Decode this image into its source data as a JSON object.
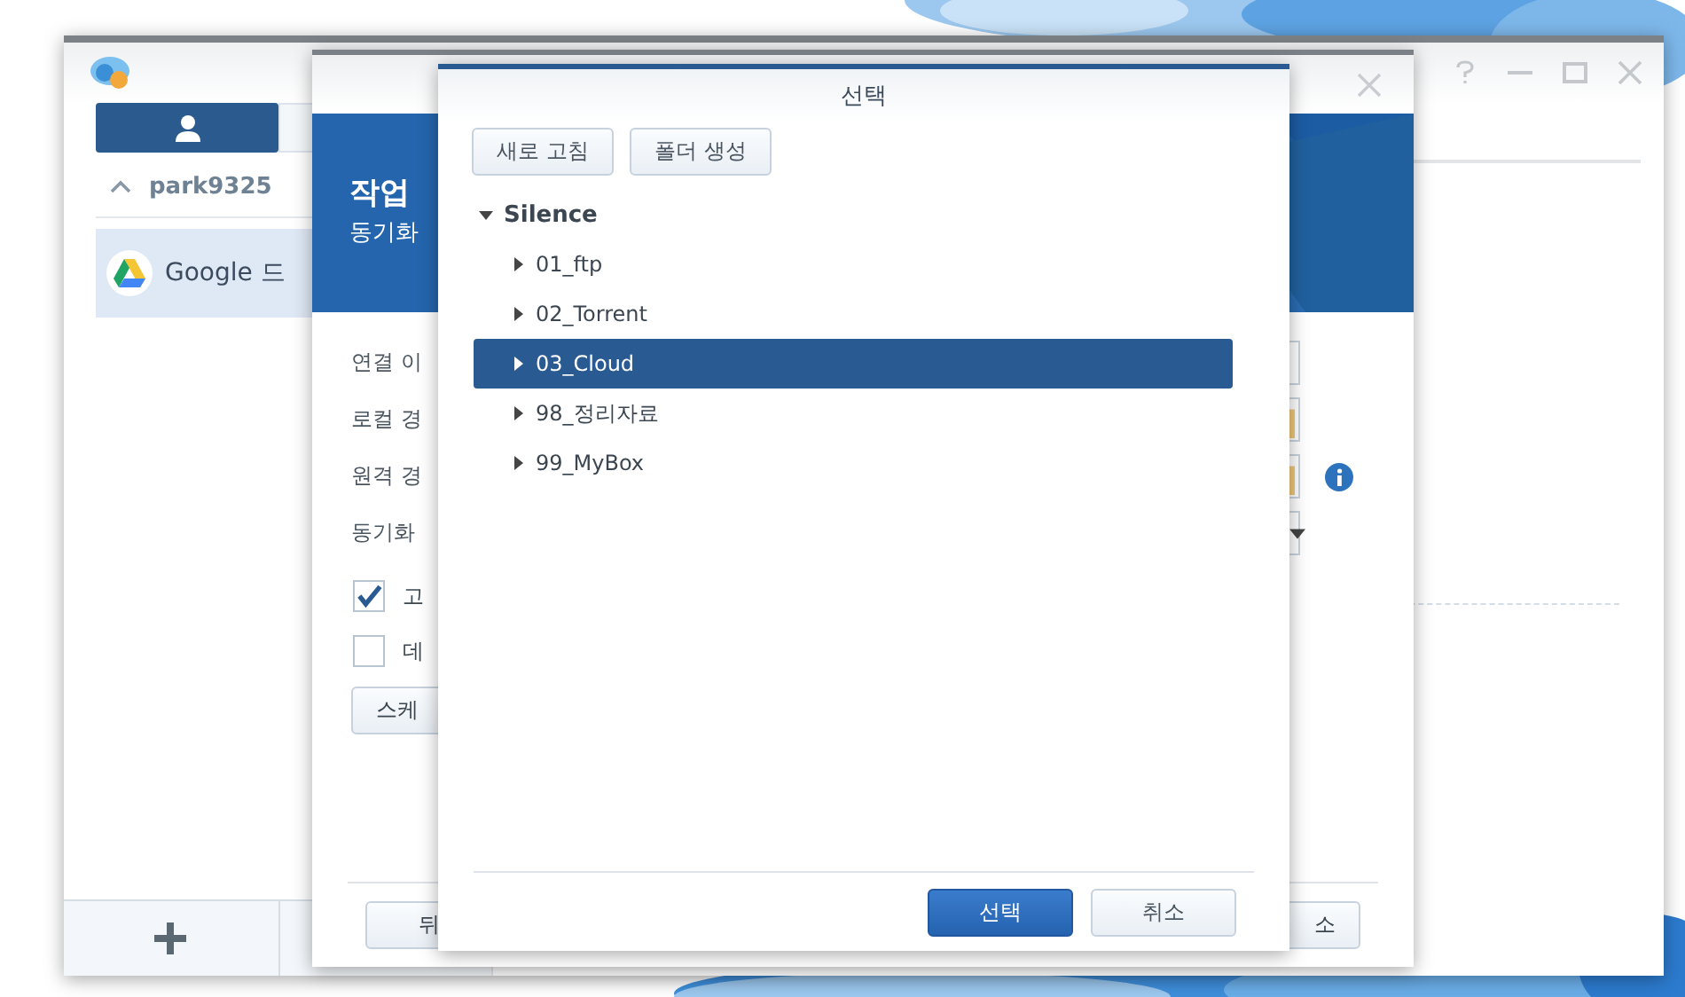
{
  "main_window": {
    "account": {
      "name": "park9325",
      "expanded": true
    },
    "connections": [
      {
        "label": "Google 드",
        "selected": true
      }
    ]
  },
  "wizard": {
    "title": "작업",
    "subtitle": "동기화",
    "fields": [
      {
        "label": "연결 이",
        "kind": "text",
        "info": false
      },
      {
        "label": "로컬 경",
        "kind": "folder",
        "info": false
      },
      {
        "label": "원격 경",
        "kind": "folder",
        "info": true
      },
      {
        "label": "동기화",
        "kind": "select",
        "info": false
      }
    ],
    "checkboxes": [
      {
        "label": "고",
        "checked": true
      },
      {
        "label": "데",
        "checked": false
      }
    ],
    "schedule_button": "스케",
    "buttons": [
      "뒤",
      "소"
    ]
  },
  "dialog": {
    "title": "선택",
    "toolbar": [
      "새로 고침",
      "폴더 생성"
    ],
    "tree": {
      "label": "Silence",
      "expanded": true,
      "children": [
        {
          "label": "01_ftp",
          "expanded": false,
          "selected": false
        },
        {
          "label": "02_Torrent",
          "expanded": false,
          "selected": false
        },
        {
          "label": "03_Cloud",
          "expanded": false,
          "selected": true
        },
        {
          "label": "98_정리자료",
          "expanded": false,
          "selected": false
        },
        {
          "label": "99_MyBox",
          "expanded": false,
          "selected": false
        }
      ]
    },
    "buttons": [
      {
        "label": "선택",
        "kind": "primary"
      },
      {
        "label": "취소",
        "kind": "secondary"
      }
    ]
  }
}
